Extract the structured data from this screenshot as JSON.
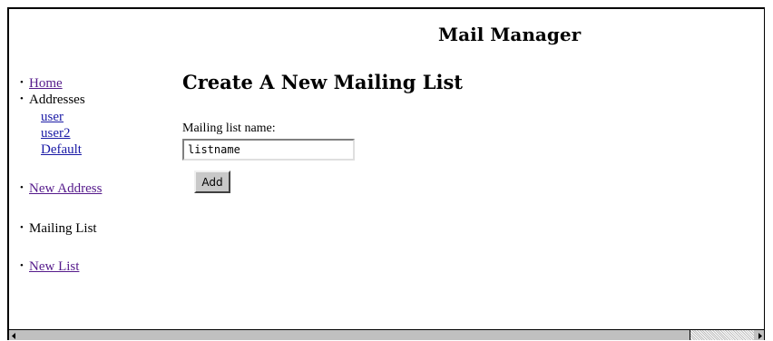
{
  "app": {
    "title": "Mail Manager"
  },
  "nav": {
    "home": "Home",
    "addresses": "Addresses",
    "address_items": [
      "user",
      "user2",
      "Default"
    ],
    "new_address": "New Address",
    "mailing_list": "Mailing List",
    "new_list": "New List"
  },
  "main": {
    "heading": "Create A New Mailing List",
    "field_label": "Mailing list name:",
    "field_value": "listname",
    "add_button": "Add"
  },
  "icons": {
    "scroll_left": "arrow-left-icon",
    "scroll_right": "arrow-right-icon"
  },
  "colors": {
    "link": "#1a1aa6",
    "visited_link": "#551a8b",
    "button_face": "#c8c8c8",
    "scrollbar": "#c0c0c0"
  }
}
